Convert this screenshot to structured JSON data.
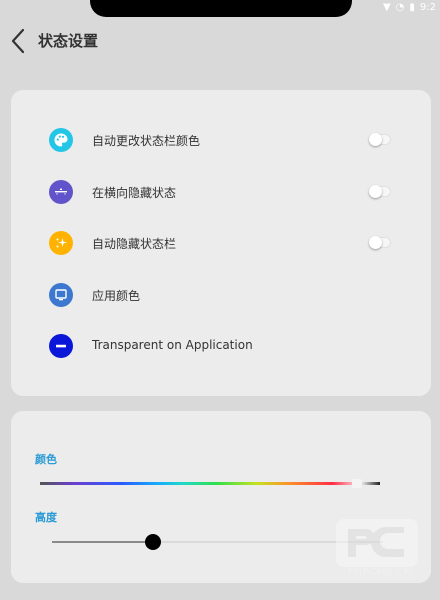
{
  "header": {
    "title": "状态设置"
  },
  "status_bar": {
    "time": "9:2"
  },
  "options": [
    {
      "label": "自动更改状态栏颜色",
      "icon": "palette-icon",
      "icon_color": "#24c6e8",
      "toggle": "off"
    },
    {
      "label": "在横向隐藏状态",
      "icon": "landscape-statusbar-icon",
      "icon_color": "#6153c9",
      "toggle": "off"
    },
    {
      "label": "自动隐藏状态栏",
      "icon": "sparkle-icon",
      "icon_color": "#ffb300",
      "toggle": "off"
    },
    {
      "label": "应用颜色",
      "icon": "monitor-icon",
      "icon_color": "#3c78d0"
    },
    {
      "label": "Transparent on Application",
      "icon": "minus-circle-icon",
      "icon_color": "#0a16d8"
    }
  ],
  "color_section": {
    "label": "颜色",
    "selected_position": 0.93
  },
  "height_section": {
    "label": "高度",
    "value": 0.3
  },
  "accent_color": "#2a9bd6",
  "watermark": {
    "text": "PHPCMS.CN"
  }
}
